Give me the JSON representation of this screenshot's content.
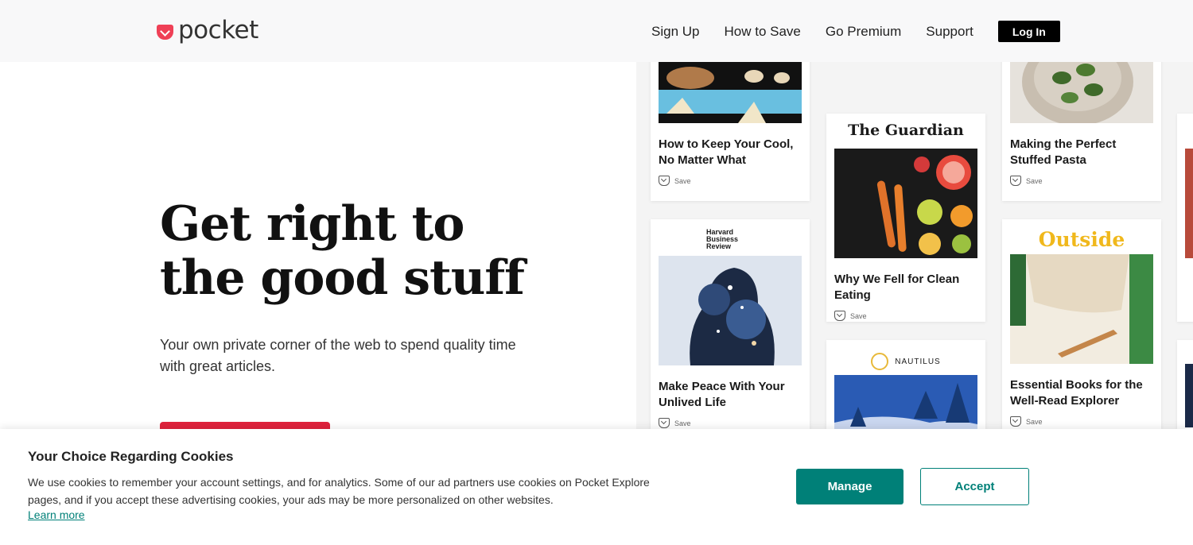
{
  "header": {
    "logo_text": "pocket",
    "nav": [
      "Sign Up",
      "How to Save",
      "Go Premium",
      "Support"
    ],
    "login_label": "Log In"
  },
  "hero": {
    "title_line1": "Get right to",
    "title_line2": "the good stuff",
    "subtitle": "Your own private corner of the web to spend quality time with great articles."
  },
  "cards": {
    "save_label": "Save",
    "c1_title": "How to Keep Your Cool, No Matter What",
    "c2_publisher": "The Guardian",
    "c2_title": "Why We Fell for Clean Eating",
    "c3_title": "Making the Perfect Stuffed Pasta",
    "c4_publisher": "Harvard Business Review",
    "c4_title": "Make Peace With Your Unlived Life",
    "c5_publisher": "NAUTILUS",
    "c6_publisher": "Outside",
    "c6_title": "Essential Books for the Well-Read Explorer"
  },
  "cookie": {
    "title": "Your Choice Regarding Cookies",
    "text": "We use cookies to remember your account settings, and for analytics. Some of our ad partners use cookies on Pocket Explore pages, and if you accept these advertising cookies, your ads may be more personalized on other websites.",
    "learn_more": "Learn more",
    "manage_label": "Manage",
    "accept_label": "Accept"
  },
  "colors": {
    "brand_red": "#ef4056",
    "cta_red": "#e0223c",
    "teal": "#008078"
  }
}
